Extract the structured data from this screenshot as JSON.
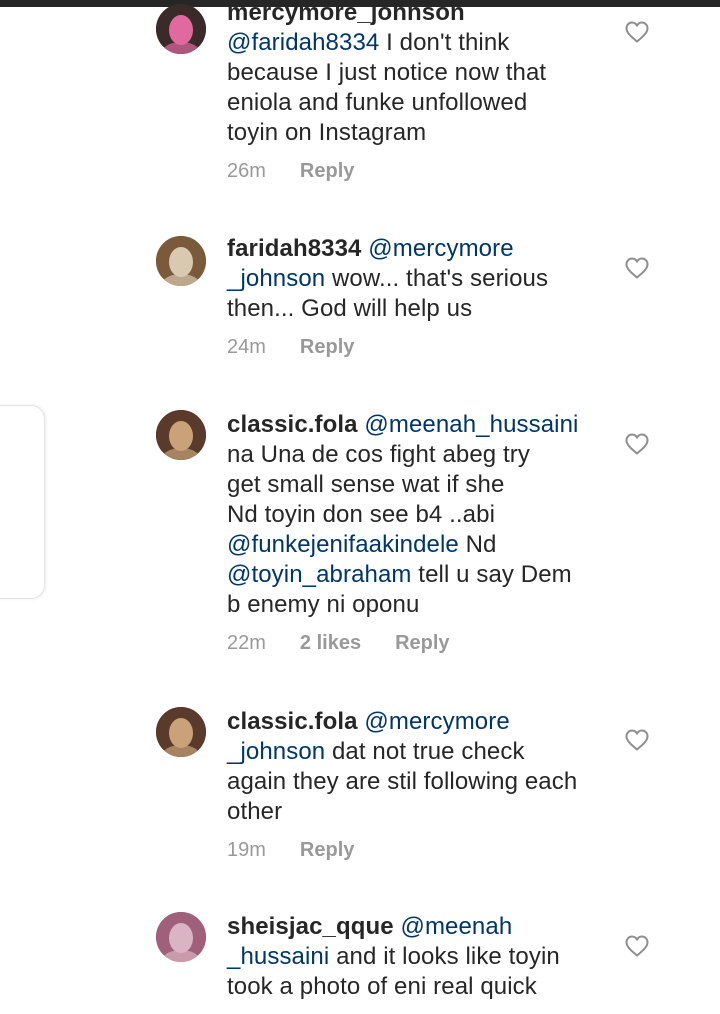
{
  "comments": [
    {
      "username": "mercymore_johnson",
      "line1_rest": "",
      "lines": [
        {
          "mention": "@faridah8334",
          "text": " I don't think"
        },
        {
          "mention": "",
          "text": "because I just notice now that"
        },
        {
          "mention": "",
          "text": "eniola and funke  unfollowed"
        },
        {
          "mention": "",
          "text": "toyin on Instagram"
        }
      ],
      "time": "26m",
      "likes": "",
      "reply": "Reply",
      "avatar_color": "#3b2a2a",
      "accent": "#e06aa0"
    },
    {
      "username": "faridah8334",
      "line1_rest": " @mercymore",
      "lines": [
        {
          "mention": "_johnson",
          "text": " wow... that's serious"
        },
        {
          "mention": "",
          "text": "then... God will help us"
        }
      ],
      "time": "24m",
      "likes": "",
      "reply": "Reply",
      "avatar_color": "#7a5a3a",
      "accent": "#d8c9b0"
    },
    {
      "username": "classic.fola",
      "line1_rest": " @meenah_hussaini",
      "lines": [
        {
          "mention": "",
          "text": "na Una de cos fight abeg try"
        },
        {
          "mention": "",
          "text": "get small sense wat if she"
        },
        {
          "mention": "",
          "text": "Nd toyin don see b4 ..abi"
        },
        {
          "mention": "@funkejenifaakindele",
          "text": "  Nd"
        },
        {
          "mention": "@toyin_abraham",
          "text": "  tell u say Dem"
        },
        {
          "mention": "",
          "text": "b enemy ni oponu"
        }
      ],
      "time": "22m",
      "likes": "2 likes",
      "reply": "Reply",
      "avatar_color": "#5a3a2a",
      "accent": "#c9a27a"
    },
    {
      "username": "classic.fola",
      "line1_rest": " @mercymore",
      "lines": [
        {
          "mention": "_johnson",
          "text": "  dat not true check"
        },
        {
          "mention": "",
          "text": "again they are stil following each"
        },
        {
          "mention": "",
          "text": "other"
        }
      ],
      "time": "19m",
      "likes": "",
      "reply": "Reply",
      "avatar_color": "#5a3a2a",
      "accent": "#c9a27a"
    },
    {
      "username": "sheisjac_qque",
      "line1_rest": " @meenah",
      "lines": [
        {
          "mention": "_hussaini",
          "text": " and it looks like toyin"
        },
        {
          "mention": "",
          "text": "took a photo of eni real quick"
        }
      ],
      "time": "",
      "likes": "",
      "reply": "",
      "avatar_color": "#a0607a",
      "accent": "#d9b4c2"
    }
  ]
}
